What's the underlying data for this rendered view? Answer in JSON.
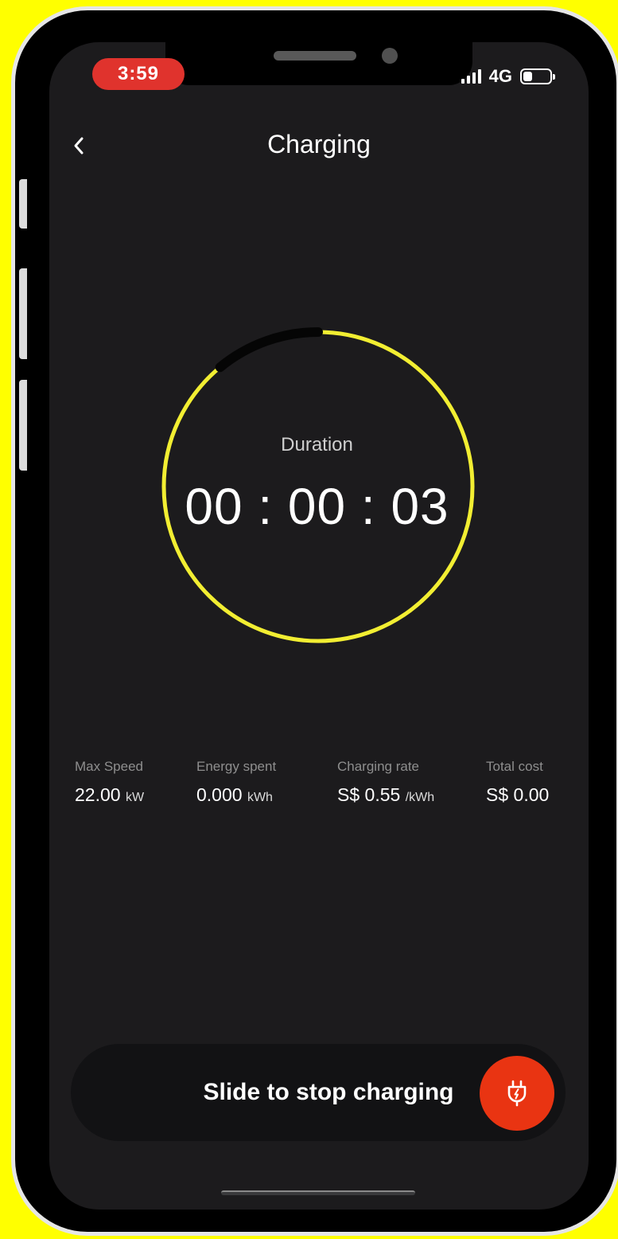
{
  "status_bar": {
    "time": "3:59",
    "network": "4G",
    "battery_level": 0.3
  },
  "header": {
    "back_icon": "chevron-left-icon",
    "title": "Charging"
  },
  "timer": {
    "label": "Duration",
    "value": "00 : 00 : 03",
    "progress_fraction": 0.89
  },
  "stats": [
    {
      "label": "Max Speed",
      "value": "22.00",
      "unit": "kW"
    },
    {
      "label": "Energy spent",
      "value": "0.000",
      "unit": "kWh"
    },
    {
      "label": "Charging rate",
      "value": "S$ 0.55",
      "unit": "/kWh"
    },
    {
      "label": "Total cost",
      "value": "S$ 0.00",
      "unit": ""
    }
  ],
  "slider": {
    "label": "Slide to stop charging",
    "knob_icon": "plug-icon"
  },
  "colors": {
    "background_frame": "#ffff00",
    "screen": "#1c1b1d",
    "ring_accent": "#f2ee32",
    "ring_track": "#050505",
    "stop_button": "#e93412",
    "time_pill": "#e0332d"
  }
}
